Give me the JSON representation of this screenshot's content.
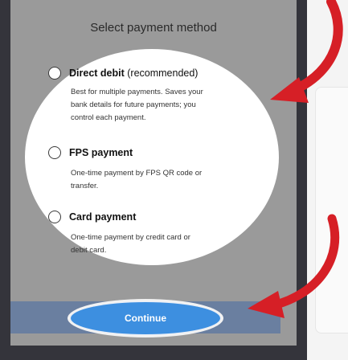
{
  "sheet": {
    "title": "Select payment method"
  },
  "options": [
    {
      "title": "Direct debit",
      "suffix": " (recommended)",
      "description_lines": [
        "Best for multiple payments. Saves your",
        "bank details for future payments; you",
        "control each payment."
      ],
      "selected": false
    },
    {
      "title": "FPS payment",
      "suffix": "",
      "description_lines": [
        "One-time payment by FPS QR code or",
        "transfer."
      ],
      "selected": false
    },
    {
      "title": "Card payment",
      "suffix": "",
      "description_lines": [
        "One-time payment by credit card or",
        "debit card."
      ],
      "selected": false
    }
  ],
  "continue": {
    "label": "Continue"
  },
  "colors": {
    "accent_button": "#3d8fe0",
    "annotation_arrow": "#d61f26",
    "frame": "#34343b"
  },
  "icons": [
    "radio-icon",
    "annotation-arrow-icon"
  ]
}
